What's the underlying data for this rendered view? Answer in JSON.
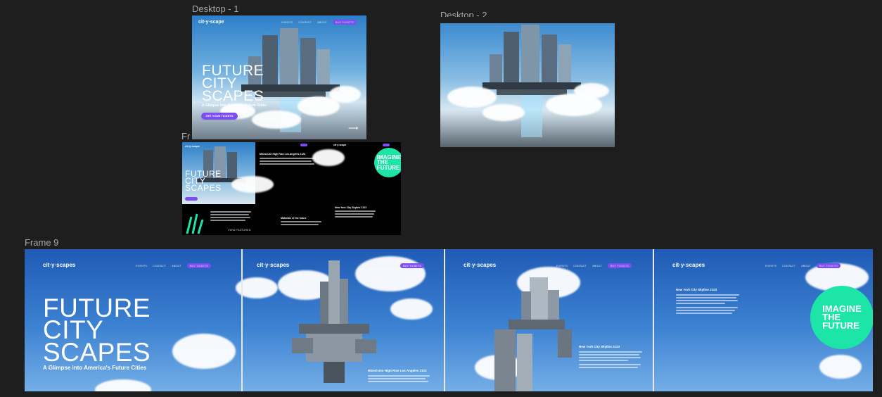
{
  "labels": {
    "desktop1": "Desktop - 1",
    "desktop2": "Desktop - 2",
    "frame8": "Fr",
    "frame9": "Frame 9"
  },
  "brand": {
    "logo_dots": "cit·y·scape",
    "logo_plural": "cit·y·scapes",
    "accent": "#7b4df2",
    "mint": "#1de5a8"
  },
  "nav": {
    "links": [
      "EVENTS",
      "CONTACT",
      "ABOUT"
    ],
    "cta": "BUY TICKETS"
  },
  "hero": {
    "title": "FUTURE\nCITY\nSCAPES",
    "subtitle": "A Glimpse into America's Future Cities",
    "button": "GET YOUR TICKETS"
  },
  "frame8": {
    "section_title": "Mixed-Use High Rise Los Angeles 2123",
    "heading2": "Materials of the future",
    "heading3": "New York City Skyline 2123",
    "imagine": "IMAGINE\nTHE\nFUTURE",
    "more": "VIEW FEATURED"
  },
  "frame9": {
    "panel2_title": "Mixed-Use High Rise Los Angeles 2123",
    "panel3_title": "New York City Skyline 2123",
    "panel4_title": "New York City Skyline 2123",
    "imagine": "IMAGINE\nTHE\nFUTURE"
  }
}
